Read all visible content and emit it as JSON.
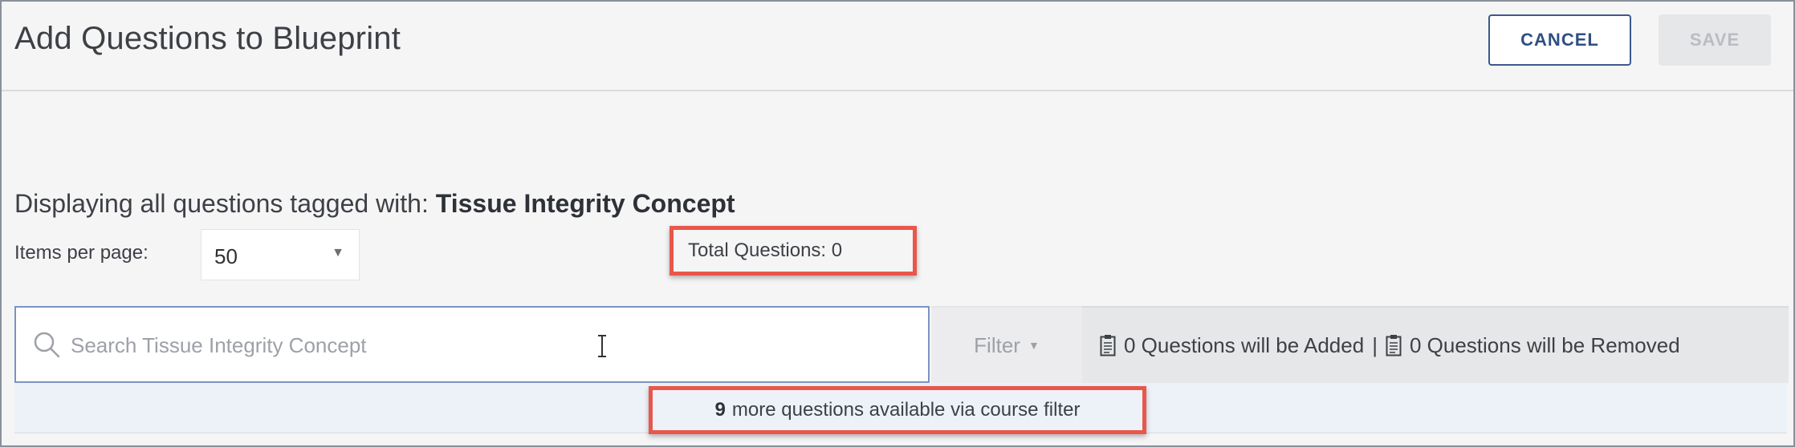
{
  "header": {
    "title": "Add Questions to Blueprint",
    "cancel_label": "CANCEL",
    "save_label": "SAVE"
  },
  "tag_line": {
    "prefix": "Displaying all questions tagged with:",
    "tag": "Tissue Integrity Concept"
  },
  "items_per_page": {
    "label": "Items per page:",
    "value": "50"
  },
  "total_questions": "Total Questions: 0",
  "search": {
    "placeholder": "Search Tissue Integrity Concept",
    "value": ""
  },
  "filter": {
    "label": "Filter"
  },
  "changes": {
    "added": "0 Questions will be Added",
    "separator": "|",
    "removed": "0 Questions will be Removed"
  },
  "more_questions": {
    "count": "9",
    "text": "more questions available via course filter"
  },
  "icons": {
    "search": "search-icon",
    "caret": "caret-down-icon",
    "clipboard": "clipboard-icon",
    "text_cursor": "text-cursor-icon"
  },
  "colors": {
    "highlight": "#e8574a",
    "primary": "#2f4f82",
    "search_border": "#7b93c1"
  }
}
